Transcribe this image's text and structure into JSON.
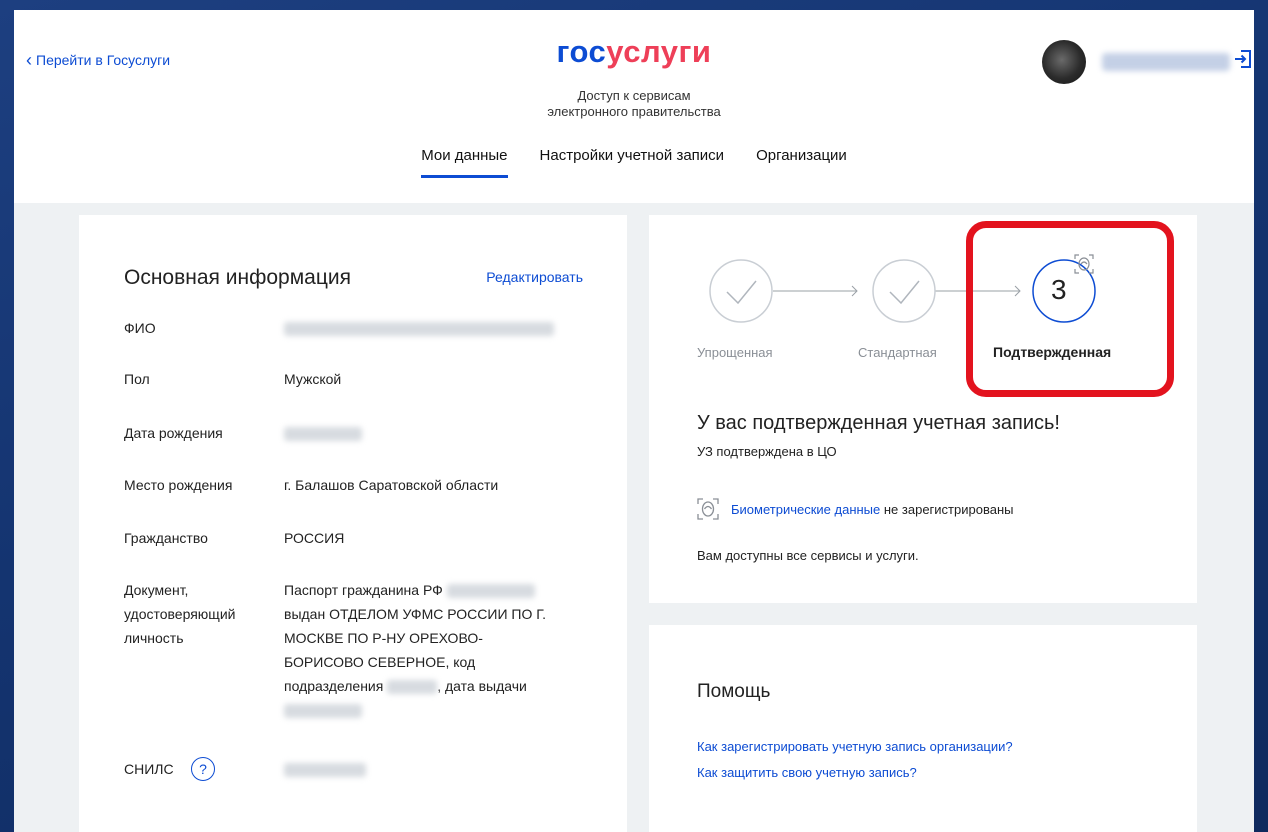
{
  "header": {
    "back_label": "Перейти в Госуслуги",
    "logo_part1": "гос",
    "logo_part2": "услуги",
    "subtitle_line1": "Доступ к сервисам",
    "subtitle_line2": "электронного правительства",
    "user_icon": "avatar",
    "logout_icon": "logout-icon"
  },
  "nav": {
    "tabs": [
      {
        "label": "Мои данные",
        "active": true
      },
      {
        "label": "Настройки учетной записи",
        "active": false
      },
      {
        "label": "Организации",
        "active": false
      }
    ]
  },
  "main_info": {
    "title": "Основная информация",
    "edit_label": "Редактировать",
    "rows": {
      "fio": {
        "label": "ФИО"
      },
      "gender": {
        "label": "Пол",
        "value": "Мужской"
      },
      "birth_date": {
        "label": "Дата рождения"
      },
      "birth_place": {
        "label": "Место рождения",
        "value": "г. Балашов Саратовской области"
      },
      "citizenship": {
        "label": "Гражданство",
        "value": "РОССИЯ"
      },
      "document": {
        "label_lines": [
          "Документ,",
          "удостоверяющий",
          "личность"
        ],
        "value_lines": {
          "l1": "Паспорт гражданина РФ",
          "l2": "выдан ОТДЕЛОМ УФМС РОССИИ ПО Г.",
          "l3": "МОСКВЕ ПО Р-НУ ОРЕХОВО-",
          "l4": "БОРИСОВО СЕВЕРНОЕ, код",
          "l5a": "подразделения",
          "l5b": ", дата выдачи"
        }
      },
      "snils": {
        "label": "СНИЛС",
        "help_glyph": "?"
      }
    }
  },
  "status": {
    "steps": [
      {
        "label": "Упрощенная",
        "state": "done"
      },
      {
        "label": "Стандартная",
        "state": "done"
      },
      {
        "label": "Подтвержденная",
        "state": "current",
        "number": "3"
      }
    ],
    "title": "У вас подтвержденная учетная запись!",
    "subtitle": "УЗ подтверждена в ЦО",
    "biometric_link": "Биометрические данные",
    "biometric_suffix": "не зарегистрированы",
    "services_text": "Вам доступны все сервисы и услуги.",
    "accent_color": "#0d4cd3",
    "highlight_color": "#e3131e"
  },
  "help": {
    "title": "Помощь",
    "links": [
      "Как зарегистрировать учетную запись организации?",
      "Как защитить свою учетную запись?"
    ]
  }
}
